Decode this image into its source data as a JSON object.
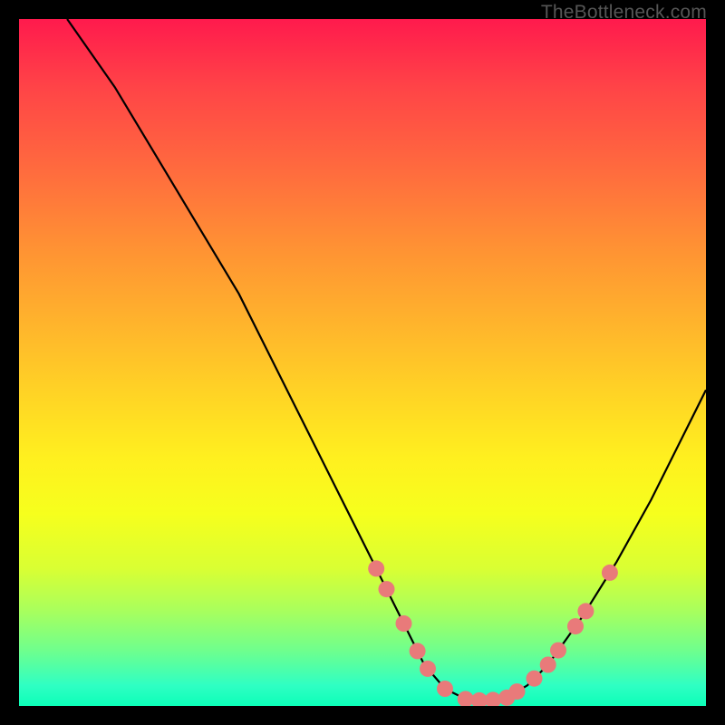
{
  "attribution": "TheBottleneck.com",
  "chart_data": {
    "type": "line",
    "title": "",
    "xlabel": "",
    "ylabel": "",
    "xlim": [
      0,
      100
    ],
    "ylim": [
      0,
      100
    ],
    "curve_points": [
      {
        "x": 7,
        "y": 100
      },
      {
        "x": 14,
        "y": 90
      },
      {
        "x": 20,
        "y": 80
      },
      {
        "x": 26,
        "y": 70
      },
      {
        "x": 32,
        "y": 60
      },
      {
        "x": 37,
        "y": 50
      },
      {
        "x": 42,
        "y": 40
      },
      {
        "x": 47,
        "y": 30
      },
      {
        "x": 52,
        "y": 20
      },
      {
        "x": 56,
        "y": 12
      },
      {
        "x": 59,
        "y": 6
      },
      {
        "x": 62,
        "y": 2.5
      },
      {
        "x": 65,
        "y": 1
      },
      {
        "x": 68,
        "y": 0.7
      },
      {
        "x": 71,
        "y": 1.2
      },
      {
        "x": 74,
        "y": 3
      },
      {
        "x": 77,
        "y": 6
      },
      {
        "x": 82,
        "y": 13
      },
      {
        "x": 87,
        "y": 21
      },
      {
        "x": 92,
        "y": 30
      },
      {
        "x": 97,
        "y": 40
      },
      {
        "x": 100,
        "y": 46
      }
    ],
    "markers_x": [
      52,
      53.5,
      56,
      58,
      59.5,
      62,
      65,
      67,
      69,
      71,
      72.5,
      75,
      77,
      78.5,
      81,
      82.5,
      86
    ],
    "marker_color": "#e97a7a",
    "marker_radius": 9
  }
}
